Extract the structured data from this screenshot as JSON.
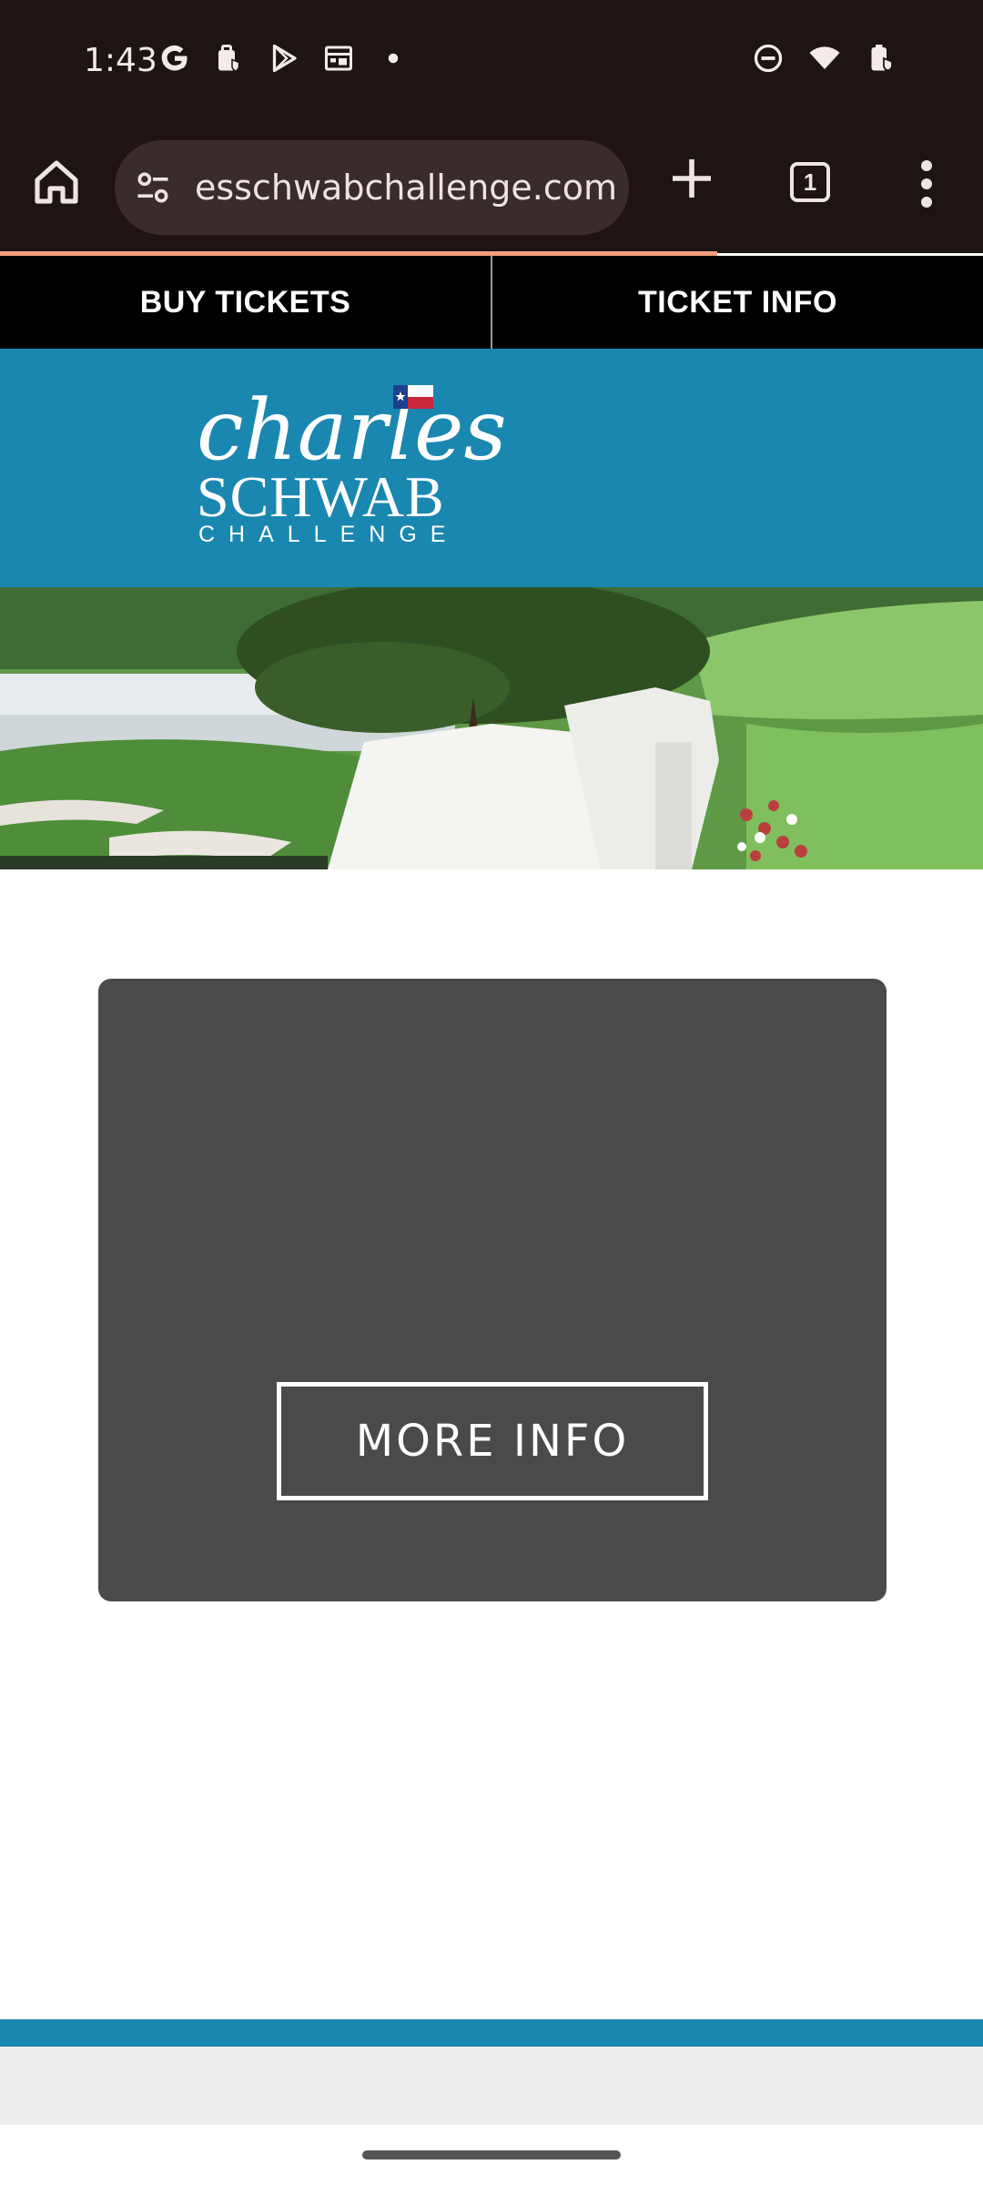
{
  "status_bar": {
    "time": "1:43",
    "left_icons": [
      "google-g-icon",
      "work-profile-icon",
      "play-store-icon",
      "calendar-icon",
      "dot-icon"
    ],
    "right_icons": [
      "do-not-disturb-icon",
      "wifi-icon",
      "battery-charging-icon"
    ]
  },
  "browser": {
    "url": "esschwabchallenge.com",
    "tab_count": "1",
    "load_progress_percent": 73,
    "colors": {
      "toolbar_bg": "#1e1414",
      "url_pill_bg": "#3a2c2b",
      "progress": "#f0a080"
    }
  },
  "site_nav": {
    "buy_tickets": "BUY TICKETS",
    "ticket_info": "TICKET INFO"
  },
  "logo": {
    "line1": "charles",
    "line2": "SCHWAB",
    "line3": "CHALLENGE"
  },
  "card": {
    "button_label": "MORE INFO"
  },
  "colors": {
    "brand_blue": "#1a87b0",
    "card_bg": "#4a4a4a",
    "nav_bg": "#000000"
  }
}
